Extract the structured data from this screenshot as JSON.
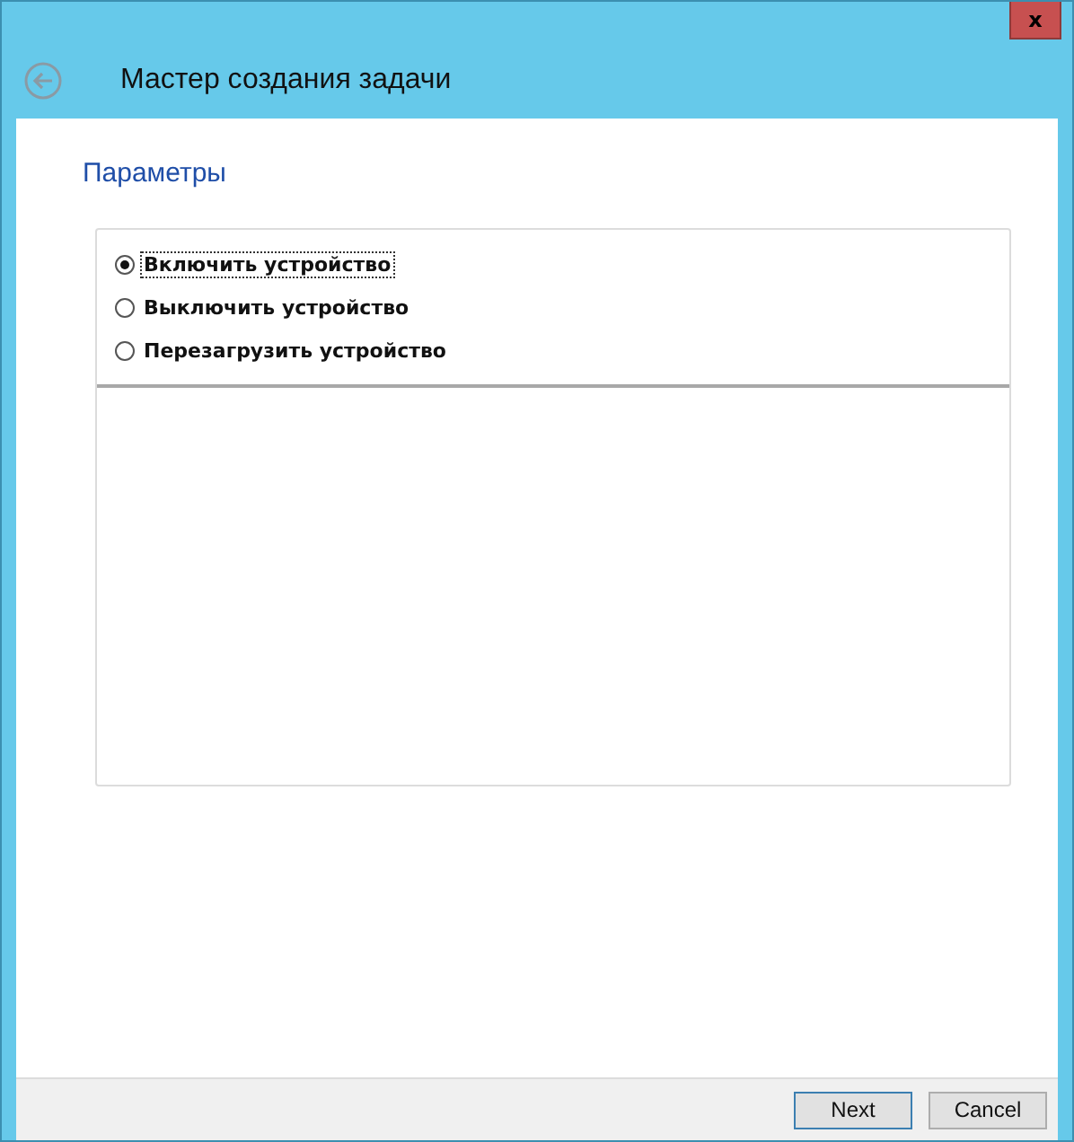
{
  "window": {
    "title": "Мастер создания задачи",
    "close": "x"
  },
  "page_title": "Параметры",
  "options": [
    {
      "label": "Включить устройство",
      "selected": true
    },
    {
      "label": "Выключить устройство",
      "selected": false
    },
    {
      "label": "Перезагрузить устройство",
      "selected": false
    }
  ],
  "buttons": [
    {
      "label": "Next",
      "kind": "default"
    },
    {
      "label": "Cancel",
      "kind": "normal"
    }
  ]
}
